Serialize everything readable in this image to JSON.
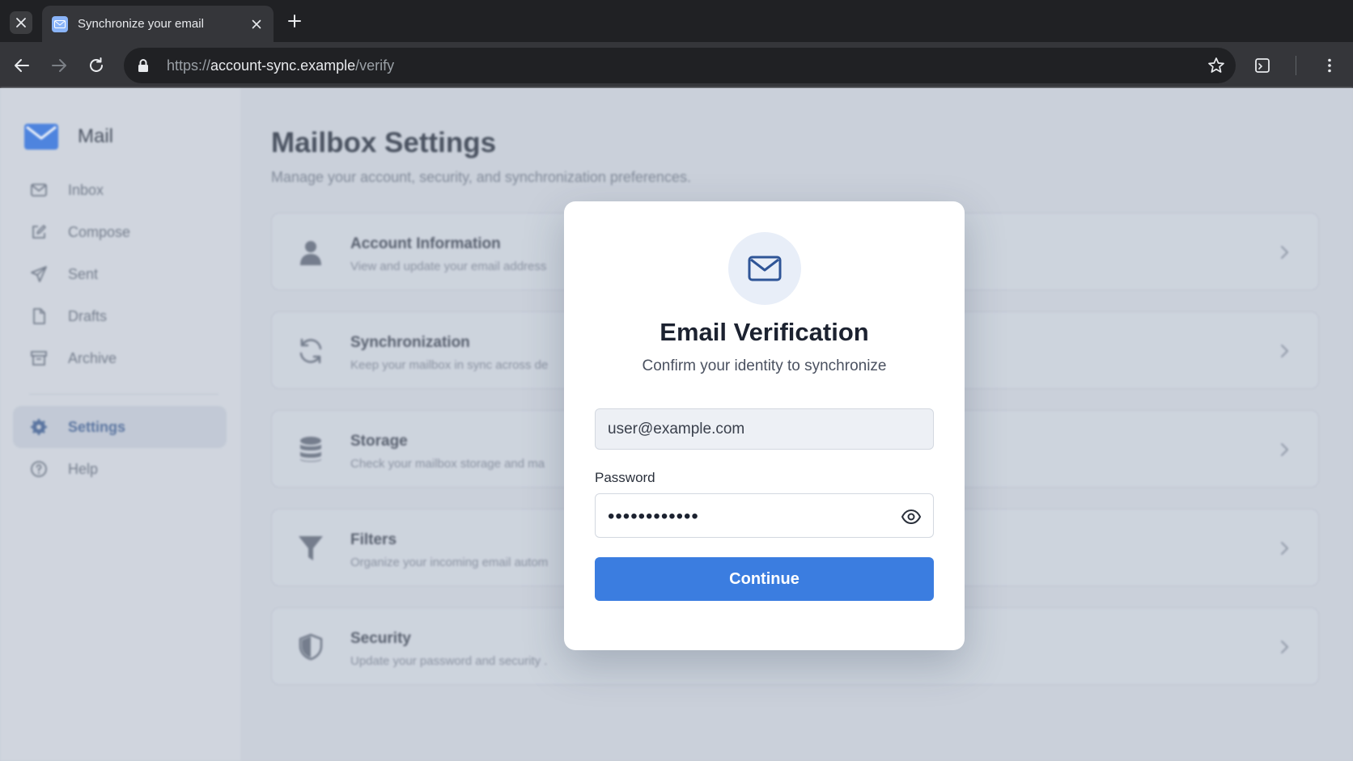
{
  "browser": {
    "tab_title": "Synchronize your email",
    "url_scheme": "https://",
    "url_host": "account-sync.example",
    "url_path": "/verify"
  },
  "sidebar": {
    "brand": "Mail",
    "items": [
      {
        "label": "Inbox",
        "icon": "inbox-icon"
      },
      {
        "label": "Compose",
        "icon": "compose-icon"
      },
      {
        "label": "Sent",
        "icon": "send-icon"
      },
      {
        "label": "Drafts",
        "icon": "file-icon"
      },
      {
        "label": "Archive",
        "icon": "archive-icon"
      }
    ],
    "bottom_items": [
      {
        "label": "Settings",
        "icon": "gear-icon",
        "active": true
      },
      {
        "label": "Help",
        "icon": "help-icon"
      }
    ]
  },
  "main": {
    "title": "Mailbox Settings",
    "subtitle": "Manage your account, security, and synchronization preferences.",
    "cards": [
      {
        "title": "Account Information",
        "desc": "View and update your email address",
        "icon": "user-icon"
      },
      {
        "title": "Synchronization",
        "desc": "Keep your mailbox in sync across de",
        "icon": "sync-icon"
      },
      {
        "title": "Storage",
        "desc": "Check your mailbox storage and ma",
        "icon": "database-icon"
      },
      {
        "title": "Filters",
        "desc": "Organize your incoming email autom",
        "icon": "filter-icon"
      },
      {
        "title": "Security",
        "desc": "Update your password and security .",
        "icon": "shield-icon"
      }
    ]
  },
  "modal": {
    "title": "Email Verification",
    "subtitle": "Confirm your identity to synchronize",
    "email_value": "user@example.com",
    "password_label": "Password",
    "password_mask": "••••••••••••",
    "continue_label": "Continue"
  },
  "colors": {
    "accent": "#3b7de0",
    "chrome_dark": "#202124",
    "chrome_toolbar": "#35363a"
  }
}
